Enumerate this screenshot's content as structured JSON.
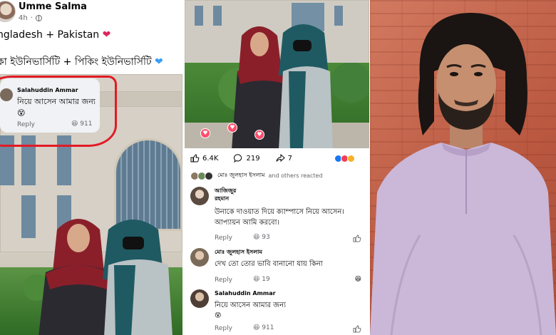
{
  "left_post": {
    "author": "Umme Salma",
    "time": "4h",
    "line1": "ngladesh + Pakistan",
    "line2": "কা ইউনিভার্সিটি + পিকিং ইউনিভার্সিটি",
    "comment": {
      "name": "Salahuddin Ammar",
      "text": "নিয়ে আসেন আমার জন্য",
      "emoji": "😵",
      "reply_label": "Reply",
      "reaction_count": "911"
    }
  },
  "mid_post": {
    "stats": {
      "likes": "6.4K",
      "comments": "219",
      "shares": "7"
    },
    "reacted_name": "মোঃ জুলহাস ইসলাম",
    "reacted_suffix": "and others reacted",
    "comments": [
      {
        "name_line1": "আজিজুর",
        "name_line2": "রহমান",
        "text_line1": "উনাকে দাওয়াত দিয়ে ক্যাম্পাসে নিয়ে আসেন।",
        "text_line2": "আপ্যায়ন আমি করবো।",
        "reply_label": "Reply",
        "reaction_count": "93"
      },
      {
        "name_line1": "মোঃ জুলহাস ইসলাম",
        "text_line1": "দেখ তো তোর ভাবি বানানো যায় কিনা",
        "reply_label": "Reply",
        "reaction_count": "19"
      },
      {
        "name_line1": "Salahuddin Ammar",
        "text_line1": "নিয়ে আসেন আমার জন্য",
        "emoji": "😵",
        "reply_label": "Reply",
        "reaction_count": "911"
      }
    ]
  },
  "colors": {
    "red_highlight": "#e21b25",
    "fb_grey_text": "#65676b",
    "fb_blue": "#1877f2"
  },
  "icons": [
    "globe-icon",
    "heart-emoji",
    "like-icon",
    "comment-icon",
    "share-icon",
    "haha-emoji"
  ]
}
